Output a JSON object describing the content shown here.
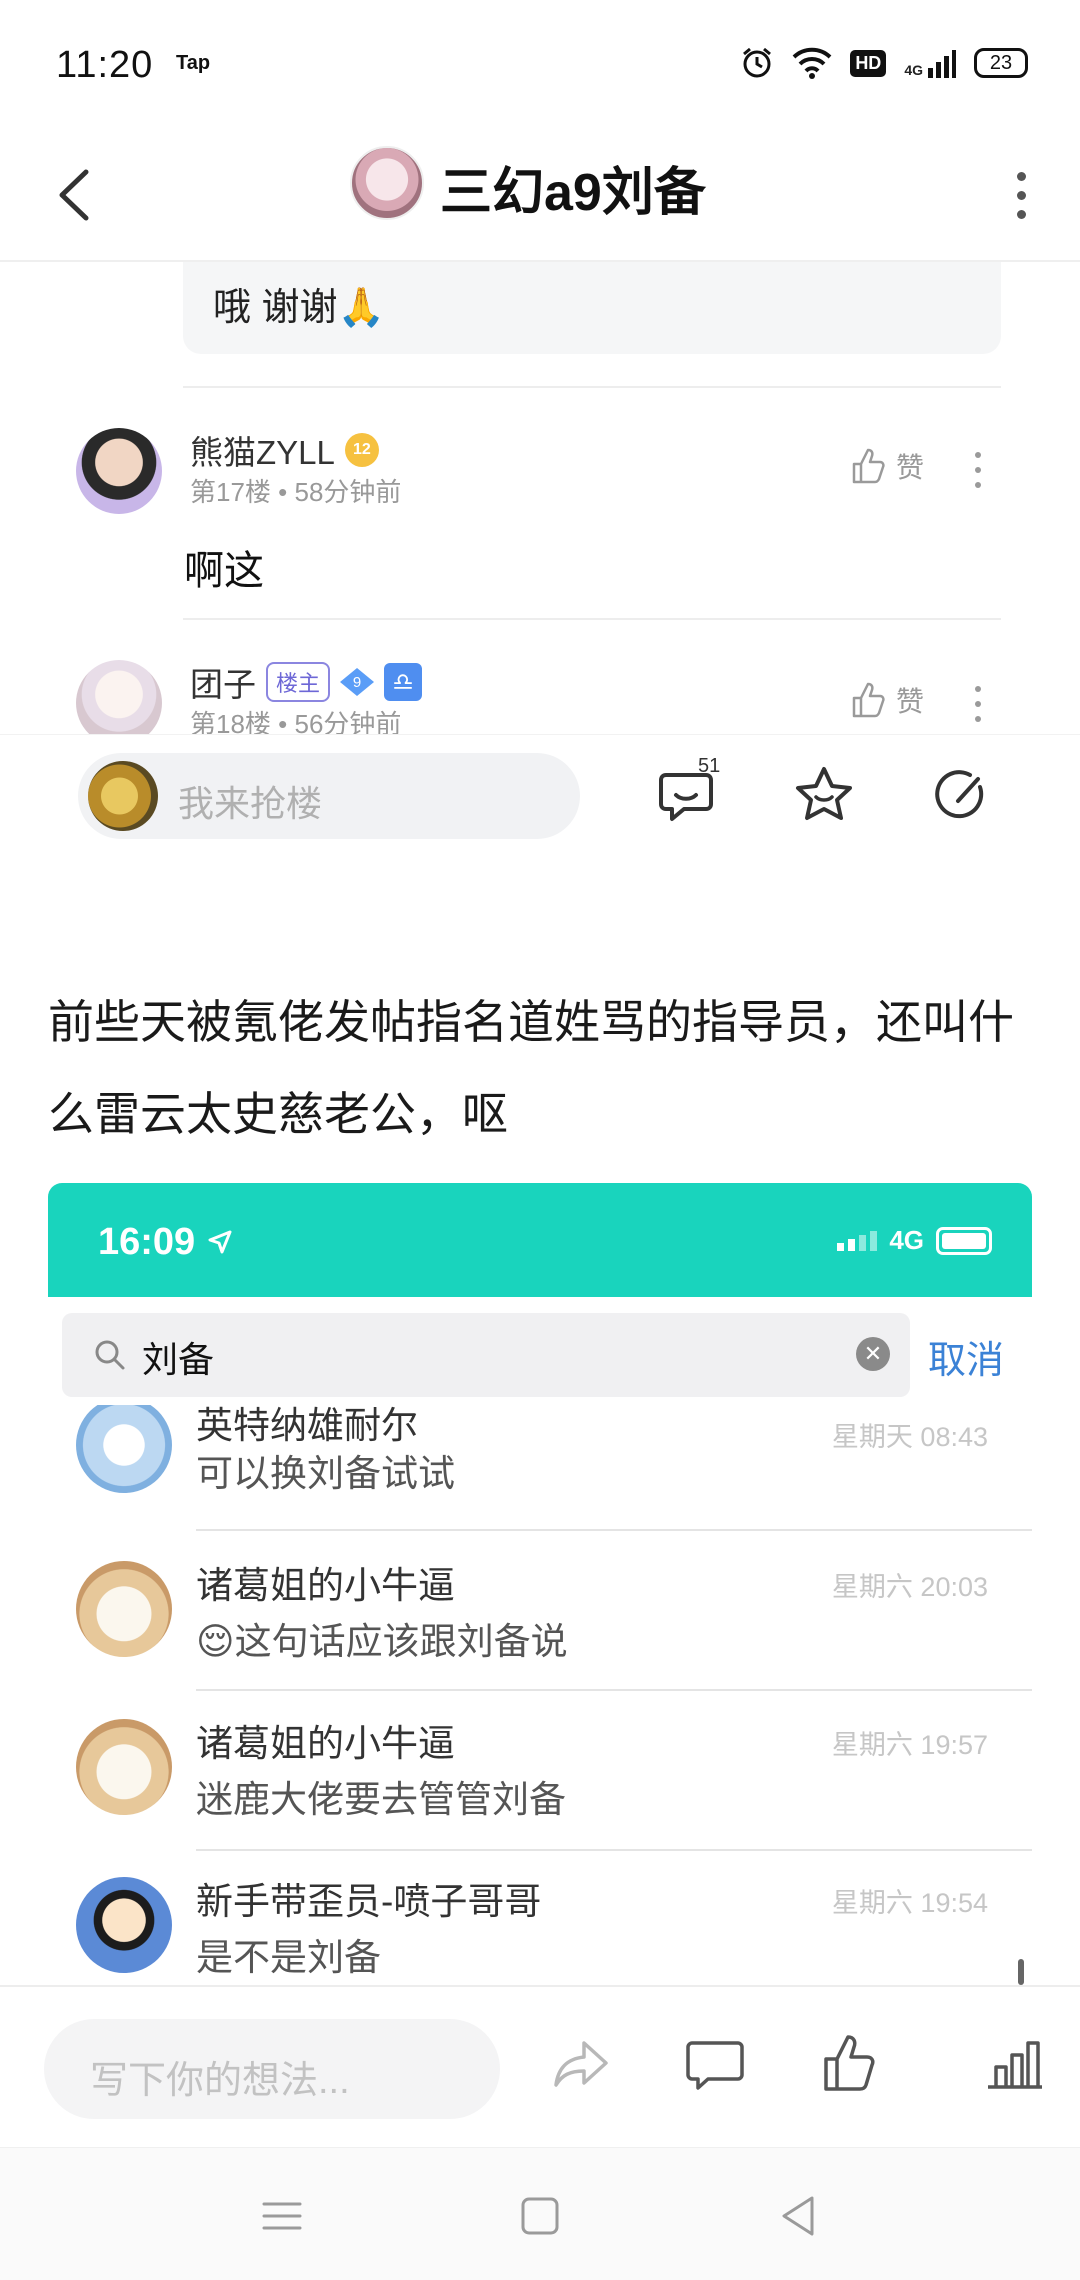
{
  "status_bar": {
    "time": "11:20",
    "app_tag": "Tap",
    "hd": "HD",
    "network": "4G",
    "battery": "23"
  },
  "header": {
    "title": "三幻a9刘备"
  },
  "reply_bubble": {
    "text": "哦 谢谢🙏"
  },
  "comments": [
    {
      "name": "熊猫ZYLL",
      "level": "12",
      "floor": "第17楼",
      "time": "58分钟前",
      "body": "啊这",
      "like_label": "赞"
    },
    {
      "name": "团子",
      "owner_tag": "楼主",
      "level": "9",
      "zodiac": "♎",
      "floor": "第18楼",
      "time": "56分钟前",
      "like_label": "赞"
    }
  ],
  "action_bar": {
    "placeholder": "我来抢楼",
    "comment_count": "51"
  },
  "post": {
    "text": "前些天被氪佬发帖指名道姓骂的指导员，还叫什么雷云太史慈老公，呕"
  },
  "embedded_screenshot": {
    "time": "16:09",
    "network": "4G",
    "search_value": "刘备",
    "cancel_label": "取消",
    "results": [
      {
        "name": "英特纳雄耐尔",
        "message": "可以换刘备试试",
        "time": "星期天 08:43"
      },
      {
        "name": "诸葛姐的小牛逼",
        "message": "😌这句话应该跟刘备说",
        "time": "星期六 20:03"
      },
      {
        "name": "诸葛姐的小牛逼",
        "message": "迷鹿大佬要去管管刘备",
        "time": "星期六 19:57"
      },
      {
        "name": "新手带歪员-喷子哥哥",
        "message": "是不是刘备",
        "time": "星期六 19:54"
      }
    ]
  },
  "bottom_bar": {
    "placeholder": "写下你的想法..."
  },
  "colors": {
    "teal_statusbar": "#19d4bd",
    "link_blue": "#3b82d6",
    "owner_purple": "#6d67d6"
  },
  "icons": [
    "back-icon",
    "more-icon",
    "thumbs-up-icon",
    "comment-icon",
    "star-icon",
    "edit-icon",
    "share-icon",
    "chart-icon",
    "search-icon",
    "clear-icon",
    "menu-icon",
    "home-icon",
    "back-triangle-icon"
  ]
}
